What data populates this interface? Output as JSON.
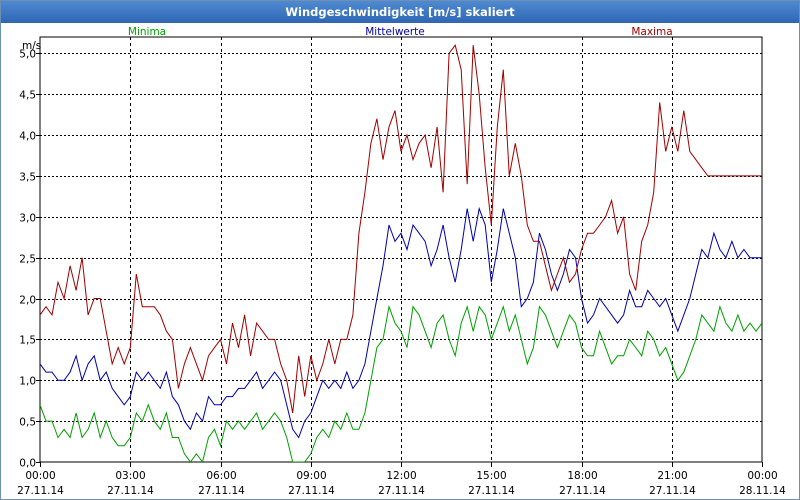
{
  "window": {
    "title": "Windgeschwindigkeit [m/s] skaliert"
  },
  "chart_data": {
    "type": "line",
    "title": "Windgeschwindigkeit [m/s] skaliert",
    "xlabel": "",
    "ylabel": "m/s",
    "ylim": [
      0,
      5.2
    ],
    "xlim": [
      0,
      24
    ],
    "x_unit": "hours from 27.11.14 00:00",
    "yticks": [
      "0,0",
      "0,5",
      "1,0",
      "1,5",
      "2,0",
      "2,5",
      "3,0",
      "3,5",
      "4,0",
      "4,5",
      "5,0"
    ],
    "xticks": [
      {
        "time": "00:00",
        "date": "27.11.14"
      },
      {
        "time": "03:00",
        "date": "27.11.14"
      },
      {
        "time": "06:00",
        "date": "27.11.14"
      },
      {
        "time": "09:00",
        "date": "27.11.14"
      },
      {
        "time": "12:00",
        "date": "27.11.14"
      },
      {
        "time": "15:00",
        "date": "27.11.14"
      },
      {
        "time": "18:00",
        "date": "27.11.14"
      },
      {
        "time": "21:00",
        "date": "27.11.14"
      },
      {
        "time": "00:00",
        "date": "28.11.14"
      }
    ],
    "grid": true,
    "legend": "top",
    "series": [
      {
        "name": "Minima",
        "color": "#00a000",
        "x": [
          0,
          0.2,
          0.4,
          0.6,
          0.8,
          1,
          1.2,
          1.4,
          1.6,
          1.8,
          2,
          2.2,
          2.4,
          2.6,
          2.8,
          3,
          3.2,
          3.4,
          3.6,
          3.8,
          4,
          4.2,
          4.4,
          4.6,
          4.8,
          5,
          5.2,
          5.4,
          5.6,
          5.8,
          6,
          6.2,
          6.4,
          6.6,
          6.8,
          7,
          7.2,
          7.4,
          7.6,
          7.8,
          8,
          8.2,
          8.4,
          8.6,
          8.8,
          9,
          9.2,
          9.4,
          9.6,
          9.8,
          10,
          10.2,
          10.4,
          10.6,
          10.8,
          11,
          11.2,
          11.4,
          11.6,
          11.8,
          12,
          12.2,
          12.4,
          12.6,
          12.8,
          13,
          13.2,
          13.4,
          13.6,
          13.8,
          14,
          14.2,
          14.4,
          14.6,
          14.8,
          15,
          15.2,
          15.4,
          15.6,
          15.8,
          16,
          16.2,
          16.4,
          16.6,
          16.8,
          17,
          17.2,
          17.4,
          17.6,
          17.8,
          18,
          18.2,
          18.4,
          18.6,
          18.8,
          19,
          19.2,
          19.4,
          19.6,
          19.8,
          20,
          20.2,
          20.4,
          20.6,
          20.8,
          21,
          21.2,
          21.4,
          21.6,
          21.8,
          22,
          22.2,
          22.4,
          22.6,
          22.8,
          23,
          23.2,
          23.4,
          23.6,
          23.8,
          24
        ],
        "y": [
          0.7,
          0.5,
          0.5,
          0.3,
          0.4,
          0.3,
          0.6,
          0.3,
          0.4,
          0.6,
          0.3,
          0.5,
          0.3,
          0.2,
          0.2,
          0.3,
          0.6,
          0.5,
          0.7,
          0.5,
          0.4,
          0.6,
          0.3,
          0.3,
          0.1,
          0.0,
          0.1,
          0.0,
          0.3,
          0.4,
          0.2,
          0.5,
          0.4,
          0.5,
          0.4,
          0.5,
          0.6,
          0.4,
          0.5,
          0.6,
          0.5,
          0.3,
          0.0,
          0.0,
          0.0,
          0.1,
          0.3,
          0.4,
          0.3,
          0.5,
          0.4,
          0.6,
          0.4,
          0.4,
          0.6,
          1.0,
          1.4,
          1.5,
          1.9,
          1.7,
          1.6,
          1.4,
          1.9,
          1.8,
          1.6,
          1.4,
          1.7,
          1.8,
          1.5,
          1.3,
          1.7,
          1.9,
          1.6,
          1.9,
          1.8,
          1.5,
          1.7,
          1.9,
          1.6,
          1.8,
          1.5,
          1.2,
          1.4,
          1.9,
          1.8,
          1.6,
          1.4,
          1.6,
          1.8,
          1.7,
          1.4,
          1.3,
          1.3,
          1.6,
          1.4,
          1.2,
          1.3,
          1.3,
          1.5,
          1.4,
          1.3,
          1.6,
          1.5,
          1.3,
          1.4,
          1.2,
          1.0,
          1.1,
          1.3,
          1.5,
          1.8,
          1.7,
          1.6,
          1.9,
          1.7,
          1.6,
          1.8,
          1.6,
          1.7,
          1.6,
          1.7
        ]
      },
      {
        "name": "Mittelwerte",
        "color": "#0000b0",
        "x": [
          0,
          0.2,
          0.4,
          0.6,
          0.8,
          1,
          1.2,
          1.4,
          1.6,
          1.8,
          2,
          2.2,
          2.4,
          2.6,
          2.8,
          3,
          3.2,
          3.4,
          3.6,
          3.8,
          4,
          4.2,
          4.4,
          4.6,
          4.8,
          5,
          5.2,
          5.4,
          5.6,
          5.8,
          6,
          6.2,
          6.4,
          6.6,
          6.8,
          7,
          7.2,
          7.4,
          7.6,
          7.8,
          8,
          8.2,
          8.4,
          8.6,
          8.8,
          9,
          9.2,
          9.4,
          9.6,
          9.8,
          10,
          10.2,
          10.4,
          10.6,
          10.8,
          11,
          11.2,
          11.4,
          11.6,
          11.8,
          12,
          12.2,
          12.4,
          12.6,
          12.8,
          13,
          13.2,
          13.4,
          13.6,
          13.8,
          14,
          14.2,
          14.4,
          14.6,
          14.8,
          15,
          15.2,
          15.4,
          15.6,
          15.8,
          16,
          16.2,
          16.4,
          16.6,
          16.8,
          17,
          17.2,
          17.4,
          17.6,
          17.8,
          18,
          18.2,
          18.4,
          18.6,
          18.8,
          19,
          19.2,
          19.4,
          19.6,
          19.8,
          20,
          20.2,
          20.4,
          20.6,
          20.8,
          21,
          21.2,
          21.4,
          21.6,
          21.8,
          22,
          22.2,
          22.4,
          22.6,
          22.8,
          23,
          23.2,
          23.4,
          23.6,
          23.8,
          24
        ],
        "y": [
          1.2,
          1.1,
          1.1,
          1.0,
          1.0,
          1.1,
          1.3,
          1.0,
          1.2,
          1.3,
          1.0,
          1.1,
          0.9,
          0.8,
          0.7,
          0.8,
          1.1,
          1.0,
          1.1,
          1.0,
          0.9,
          1.1,
          0.8,
          0.7,
          0.5,
          0.4,
          0.6,
          0.5,
          0.8,
          0.7,
          0.7,
          0.8,
          0.8,
          0.9,
          0.9,
          1.0,
          1.1,
          0.9,
          1.0,
          1.1,
          1.0,
          0.7,
          0.4,
          0.3,
          0.5,
          0.6,
          0.8,
          1.0,
          0.9,
          1.0,
          0.9,
          1.1,
          0.9,
          1.0,
          1.2,
          1.6,
          2.0,
          2.4,
          2.9,
          2.7,
          2.8,
          2.6,
          2.9,
          2.8,
          2.7,
          2.4,
          2.6,
          2.9,
          2.5,
          2.2,
          2.6,
          3.1,
          2.7,
          3.1,
          2.9,
          2.2,
          2.6,
          3.1,
          2.8,
          2.5,
          1.9,
          2.0,
          2.2,
          2.8,
          2.6,
          2.3,
          2.1,
          2.3,
          2.6,
          2.5,
          2.0,
          1.7,
          1.8,
          2.0,
          1.9,
          1.8,
          1.7,
          1.8,
          2.1,
          1.9,
          1.9,
          2.1,
          2.0,
          1.9,
          2.0,
          1.8,
          1.6,
          1.8,
          2.0,
          2.3,
          2.6,
          2.5,
          2.8,
          2.6,
          2.5,
          2.7,
          2.5,
          2.6,
          2.5,
          2.5,
          2.5
        ]
      },
      {
        "name": "Maxima",
        "color": "#a00000",
        "x": [
          0,
          0.2,
          0.4,
          0.6,
          0.8,
          1,
          1.2,
          1.4,
          1.6,
          1.8,
          2,
          2.2,
          2.4,
          2.6,
          2.8,
          3,
          3.2,
          3.4,
          3.6,
          3.8,
          4,
          4.2,
          4.4,
          4.6,
          4.8,
          5,
          5.2,
          5.4,
          5.6,
          5.8,
          6,
          6.2,
          6.4,
          6.6,
          6.8,
          7,
          7.2,
          7.4,
          7.6,
          7.8,
          8,
          8.2,
          8.4,
          8.6,
          8.8,
          9,
          9.2,
          9.4,
          9.6,
          9.8,
          10,
          10.2,
          10.4,
          10.6,
          10.8,
          11,
          11.2,
          11.4,
          11.6,
          11.8,
          12,
          12.2,
          12.4,
          12.6,
          12.8,
          13,
          13.2,
          13.4,
          13.6,
          13.8,
          14,
          14.2,
          14.4,
          14.6,
          14.8,
          15,
          15.2,
          15.4,
          15.6,
          15.8,
          16,
          16.2,
          16.4,
          16.6,
          16.8,
          17,
          17.2,
          17.4,
          17.6,
          17.8,
          18,
          18.2,
          18.4,
          18.6,
          18.8,
          19,
          19.2,
          19.4,
          19.6,
          19.8,
          20,
          20.2,
          20.4,
          20.6,
          20.8,
          21,
          21.2,
          21.4,
          21.6,
          21.8,
          22,
          22.2,
          22.4,
          22.6,
          22.8,
          23,
          23.2,
          23.4,
          23.6,
          23.8,
          24
        ],
        "y": [
          1.8,
          1.9,
          1.8,
          2.2,
          2.0,
          2.4,
          2.1,
          2.5,
          1.8,
          2.0,
          2.0,
          1.6,
          1.2,
          1.4,
          1.2,
          1.4,
          2.3,
          1.9,
          1.9,
          1.9,
          1.8,
          1.6,
          1.5,
          0.9,
          1.2,
          1.4,
          1.2,
          1.0,
          1.3,
          1.4,
          1.5,
          1.2,
          1.7,
          1.4,
          1.8,
          1.3,
          1.7,
          1.6,
          1.5,
          1.5,
          1.2,
          1.0,
          0.6,
          1.3,
          0.8,
          1.3,
          1.0,
          1.2,
          1.5,
          1.2,
          1.5,
          1.5,
          1.8,
          2.8,
          3.3,
          3.9,
          4.2,
          3.7,
          4.1,
          4.3,
          3.8,
          4.0,
          3.7,
          3.9,
          4.0,
          3.6,
          4.1,
          3.3,
          5.0,
          5.1,
          4.8,
          3.4,
          5.1,
          4.5,
          3.6,
          2.9,
          4.1,
          4.8,
          3.5,
          3.9,
          3.5,
          2.9,
          2.7,
          2.7,
          2.4,
          2.1,
          2.3,
          2.5,
          2.2,
          2.3,
          2.6,
          2.8,
          2.8,
          2.9,
          3.0,
          3.2,
          2.8,
          3.0,
          2.3,
          2.1,
          2.7,
          2.9,
          3.3,
          4.4,
          3.8,
          4.1,
          3.8,
          4.3,
          3.8,
          3.7,
          3.6,
          3.5,
          3.5,
          3.5,
          3.5,
          3.5,
          3.5,
          3.5,
          3.5,
          3.5,
          3.5
        ]
      }
    ]
  }
}
